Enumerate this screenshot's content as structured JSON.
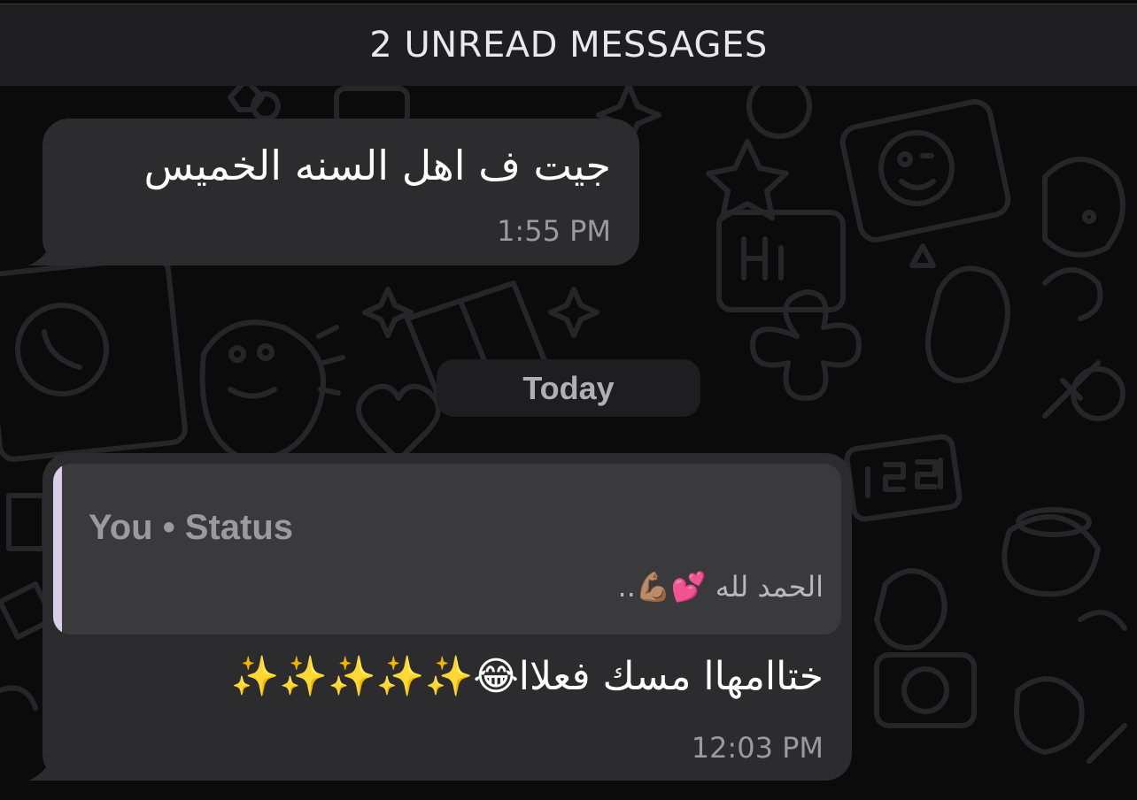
{
  "unread_banner": {
    "text": "2 UNREAD MESSAGES"
  },
  "messages": [
    {
      "text": "جيت ف اهل السنه الخميس",
      "time": "1:55 PM"
    },
    {
      "quote": {
        "author": "You • Status",
        "text": "الحمد لله 💕💪🏽.."
      },
      "text": "ختاامهاا مسك فعلاا😂✨✨✨✨✨",
      "time": "12:03 PM"
    }
  ],
  "date_separator": {
    "label": "Today"
  },
  "colors": {
    "background": "#0b0b0c",
    "bubble": "#2c2c2e",
    "quote_bg": "#3a3a3d",
    "quote_accent": "#d9cfe6",
    "timestamp": "#9a9a9f"
  }
}
